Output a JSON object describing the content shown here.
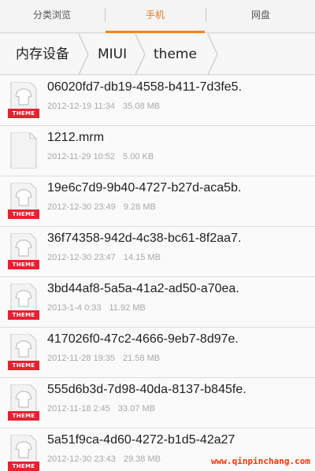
{
  "tabs": [
    {
      "label": "分类浏览"
    },
    {
      "label": "手机"
    },
    {
      "label": "网盘"
    }
  ],
  "breadcrumb": [
    {
      "label": "内存设备"
    },
    {
      "label": "MIUI"
    },
    {
      "label": "theme"
    }
  ],
  "files": [
    {
      "name": "06020fd7-db19-4558-b411-7d3fe5.",
      "date": "2012-12-19 11:34",
      "size": "35.08 MB",
      "badge": "THEME"
    },
    {
      "name": "1212.mrm",
      "date": "2012-11-29 10:52",
      "size": "5.00 KB",
      "badge": ""
    },
    {
      "name": "19e6c7d9-9b40-4727-b27d-aca5b.",
      "date": "2012-12-30 23:49",
      "size": "9.28 MB",
      "badge": "THEME"
    },
    {
      "name": "36f74358-942d-4c38-bc61-8f2aa7.",
      "date": "2012-12-30 23:47",
      "size": "14.15 MB",
      "badge": "THEME"
    },
    {
      "name": "3bd44af8-5a5a-41a2-ad50-a70ea.",
      "date": "2013-1-4 0:33",
      "size": "11.92 MB",
      "badge": "THEME"
    },
    {
      "name": "417026f0-47c2-4666-9eb7-8d97e.",
      "date": "2012-11-28 19:35",
      "size": "21.58 MB",
      "badge": "THEME"
    },
    {
      "name": "555d6b3d-7d98-40da-8137-b845fe.",
      "date": "2012-11-18 2:45",
      "size": "33.07 MB",
      "badge": "THEME"
    },
    {
      "name": "5a51f9ca-4d60-4272-b1d5-42a27",
      "date": "2012-12-30 23:43",
      "size": "29.38 MB",
      "badge": "THEME"
    }
  ],
  "watermark": "www.qinpinchang.com",
  "colors": {
    "accent": "#f0851f",
    "badge": "#e8202f"
  }
}
